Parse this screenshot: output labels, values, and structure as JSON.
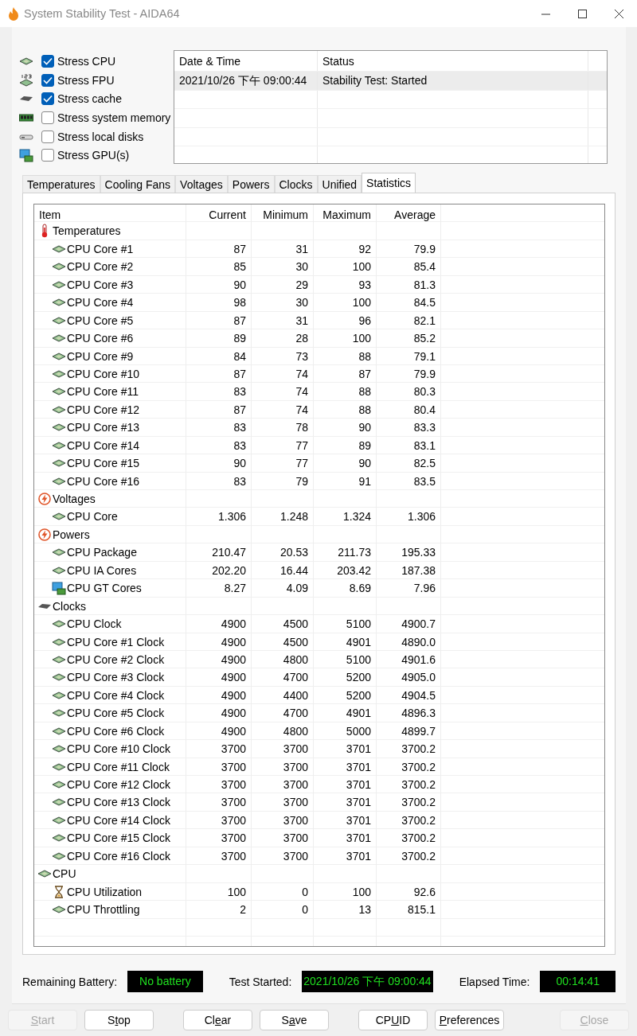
{
  "window": {
    "title": "System Stability Test - AIDA64"
  },
  "stress_options": [
    {
      "label": "Stress CPU",
      "checked": true,
      "kind": "cpu"
    },
    {
      "label": "Stress FPU",
      "checked": true,
      "kind": "fpu"
    },
    {
      "label": "Stress cache",
      "checked": true,
      "kind": "cache"
    },
    {
      "label": "Stress system memory",
      "checked": false,
      "kind": "memory"
    },
    {
      "label": "Stress local disks",
      "checked": false,
      "kind": "disk"
    },
    {
      "label": "Stress GPU(s)",
      "checked": false,
      "kind": "gpu"
    }
  ],
  "log": {
    "columns": [
      "Date & Time",
      "Status"
    ],
    "rows": [
      {
        "date_time": "2021/10/26 下午 09:00:44",
        "status": "Stability Test: Started",
        "selected": true
      }
    ]
  },
  "tabs": [
    {
      "label": "Temperatures",
      "selected": false
    },
    {
      "label": "Cooling Fans",
      "selected": false
    },
    {
      "label": "Voltages",
      "selected": false
    },
    {
      "label": "Powers",
      "selected": false
    },
    {
      "label": "Clocks",
      "selected": false
    },
    {
      "label": "Unified",
      "selected": false
    },
    {
      "label": "Statistics",
      "selected": true
    }
  ],
  "statistics": {
    "columns": [
      "Item",
      "Current",
      "Minimum",
      "Maximum",
      "Average"
    ],
    "groups": [
      {
        "label": "Temperatures",
        "kind": "thermometer",
        "children": [
          {
            "label": "CPU Core #1",
            "kind": "cpu",
            "current": "87",
            "minimum": "31",
            "maximum": "92",
            "average": "79.9"
          },
          {
            "label": "CPU Core #2",
            "kind": "cpu",
            "current": "85",
            "minimum": "30",
            "maximum": "100",
            "average": "85.4"
          },
          {
            "label": "CPU Core #3",
            "kind": "cpu",
            "current": "90",
            "minimum": "29",
            "maximum": "93",
            "average": "81.3"
          },
          {
            "label": "CPU Core #4",
            "kind": "cpu",
            "current": "98",
            "minimum": "30",
            "maximum": "100",
            "average": "84.5"
          },
          {
            "label": "CPU Core #5",
            "kind": "cpu",
            "current": "87",
            "minimum": "31",
            "maximum": "96",
            "average": "82.1"
          },
          {
            "label": "CPU Core #6",
            "kind": "cpu",
            "current": "89",
            "minimum": "28",
            "maximum": "100",
            "average": "85.2"
          },
          {
            "label": "CPU Core #9",
            "kind": "cpu",
            "current": "84",
            "minimum": "73",
            "maximum": "88",
            "average": "79.1"
          },
          {
            "label": "CPU Core #10",
            "kind": "cpu",
            "current": "87",
            "minimum": "74",
            "maximum": "87",
            "average": "79.9"
          },
          {
            "label": "CPU Core #11",
            "kind": "cpu",
            "current": "83",
            "minimum": "74",
            "maximum": "88",
            "average": "80.3"
          },
          {
            "label": "CPU Core #12",
            "kind": "cpu",
            "current": "87",
            "minimum": "74",
            "maximum": "88",
            "average": "80.4"
          },
          {
            "label": "CPU Core #13",
            "kind": "cpu",
            "current": "83",
            "minimum": "78",
            "maximum": "90",
            "average": "83.3"
          },
          {
            "label": "CPU Core #14",
            "kind": "cpu",
            "current": "83",
            "minimum": "77",
            "maximum": "89",
            "average": "83.1"
          },
          {
            "label": "CPU Core #15",
            "kind": "cpu",
            "current": "90",
            "minimum": "77",
            "maximum": "90",
            "average": "82.5"
          },
          {
            "label": "CPU Core #16",
            "kind": "cpu",
            "current": "83",
            "minimum": "79",
            "maximum": "91",
            "average": "83.5"
          }
        ]
      },
      {
        "label": "Voltages",
        "kind": "lightning",
        "children": [
          {
            "label": "CPU Core",
            "kind": "cpu",
            "current": "1.306",
            "minimum": "1.248",
            "maximum": "1.324",
            "average": "1.306"
          }
        ]
      },
      {
        "label": "Powers",
        "kind": "lightning",
        "children": [
          {
            "label": "CPU Package",
            "kind": "cpu",
            "current": "210.47",
            "minimum": "20.53",
            "maximum": "211.73",
            "average": "195.33"
          },
          {
            "label": "CPU IA Cores",
            "kind": "cpu",
            "current": "202.20",
            "minimum": "16.44",
            "maximum": "203.42",
            "average": "187.38"
          },
          {
            "label": "CPU GT Cores",
            "kind": "gpu",
            "current": "8.27",
            "minimum": "4.09",
            "maximum": "8.69",
            "average": "7.96"
          }
        ]
      },
      {
        "label": "Clocks",
        "kind": "cache",
        "children": [
          {
            "label": "CPU Clock",
            "kind": "cpu",
            "current": "4900",
            "minimum": "4500",
            "maximum": "5100",
            "average": "4900.7"
          },
          {
            "label": "CPU Core #1 Clock",
            "kind": "cpu",
            "current": "4900",
            "minimum": "4500",
            "maximum": "4901",
            "average": "4890.0"
          },
          {
            "label": "CPU Core #2 Clock",
            "kind": "cpu",
            "current": "4900",
            "minimum": "4800",
            "maximum": "5100",
            "average": "4901.6"
          },
          {
            "label": "CPU Core #3 Clock",
            "kind": "cpu",
            "current": "4900",
            "minimum": "4700",
            "maximum": "5200",
            "average": "4905.0"
          },
          {
            "label": "CPU Core #4 Clock",
            "kind": "cpu",
            "current": "4900",
            "minimum": "4400",
            "maximum": "5200",
            "average": "4904.5"
          },
          {
            "label": "CPU Core #5 Clock",
            "kind": "cpu",
            "current": "4900",
            "minimum": "4700",
            "maximum": "4901",
            "average": "4896.3"
          },
          {
            "label": "CPU Core #6 Clock",
            "kind": "cpu",
            "current": "4900",
            "minimum": "4800",
            "maximum": "5000",
            "average": "4899.7"
          },
          {
            "label": "CPU Core #10 Clock",
            "kind": "cpu",
            "current": "3700",
            "minimum": "3700",
            "maximum": "3701",
            "average": "3700.2"
          },
          {
            "label": "CPU Core #11 Clock",
            "kind": "cpu",
            "current": "3700",
            "minimum": "3700",
            "maximum": "3701",
            "average": "3700.2"
          },
          {
            "label": "CPU Core #12 Clock",
            "kind": "cpu",
            "current": "3700",
            "minimum": "3700",
            "maximum": "3701",
            "average": "3700.2"
          },
          {
            "label": "CPU Core #13 Clock",
            "kind": "cpu",
            "current": "3700",
            "minimum": "3700",
            "maximum": "3701",
            "average": "3700.2"
          },
          {
            "label": "CPU Core #14 Clock",
            "kind": "cpu",
            "current": "3700",
            "minimum": "3700",
            "maximum": "3701",
            "average": "3700.2"
          },
          {
            "label": "CPU Core #15 Clock",
            "kind": "cpu",
            "current": "3700",
            "minimum": "3700",
            "maximum": "3701",
            "average": "3700.2"
          },
          {
            "label": "CPU Core #16 Clock",
            "kind": "cpu",
            "current": "3700",
            "minimum": "3700",
            "maximum": "3701",
            "average": "3700.2"
          }
        ]
      },
      {
        "label": "CPU",
        "kind": "cpu",
        "children": [
          {
            "label": "CPU Utilization",
            "kind": "hourglass",
            "current": "100",
            "minimum": "0",
            "maximum": "100",
            "average": "92.6"
          },
          {
            "label": "CPU Throttling",
            "kind": "cpu",
            "current": "2",
            "minimum": "0",
            "maximum": "13",
            "average": "815.1"
          }
        ]
      }
    ]
  },
  "status_fields": [
    {
      "label": "Remaining Battery:",
      "value": "No battery"
    },
    {
      "label": "Test Started:",
      "value": "2021/10/26 下午 09:00:44"
    },
    {
      "label": "Elapsed Time:",
      "value": "00:14:41"
    }
  ],
  "buttons": [
    {
      "key": "S",
      "after": "tart",
      "disabled": true
    },
    {
      "before": "S",
      "key": "t",
      "after": "op",
      "disabled": false
    },
    {
      "before": "Cl",
      "key": "e",
      "after": "ar",
      "disabled": false
    },
    {
      "before": "S",
      "key": "a",
      "after": "ve",
      "disabled": false
    },
    {
      "before": "CP",
      "key": "U",
      "after": "ID",
      "disabled": false
    },
    {
      "key": "P",
      "after": "references",
      "disabled": false
    },
    {
      "key": "C",
      "after": "lose",
      "disabled": true
    }
  ]
}
